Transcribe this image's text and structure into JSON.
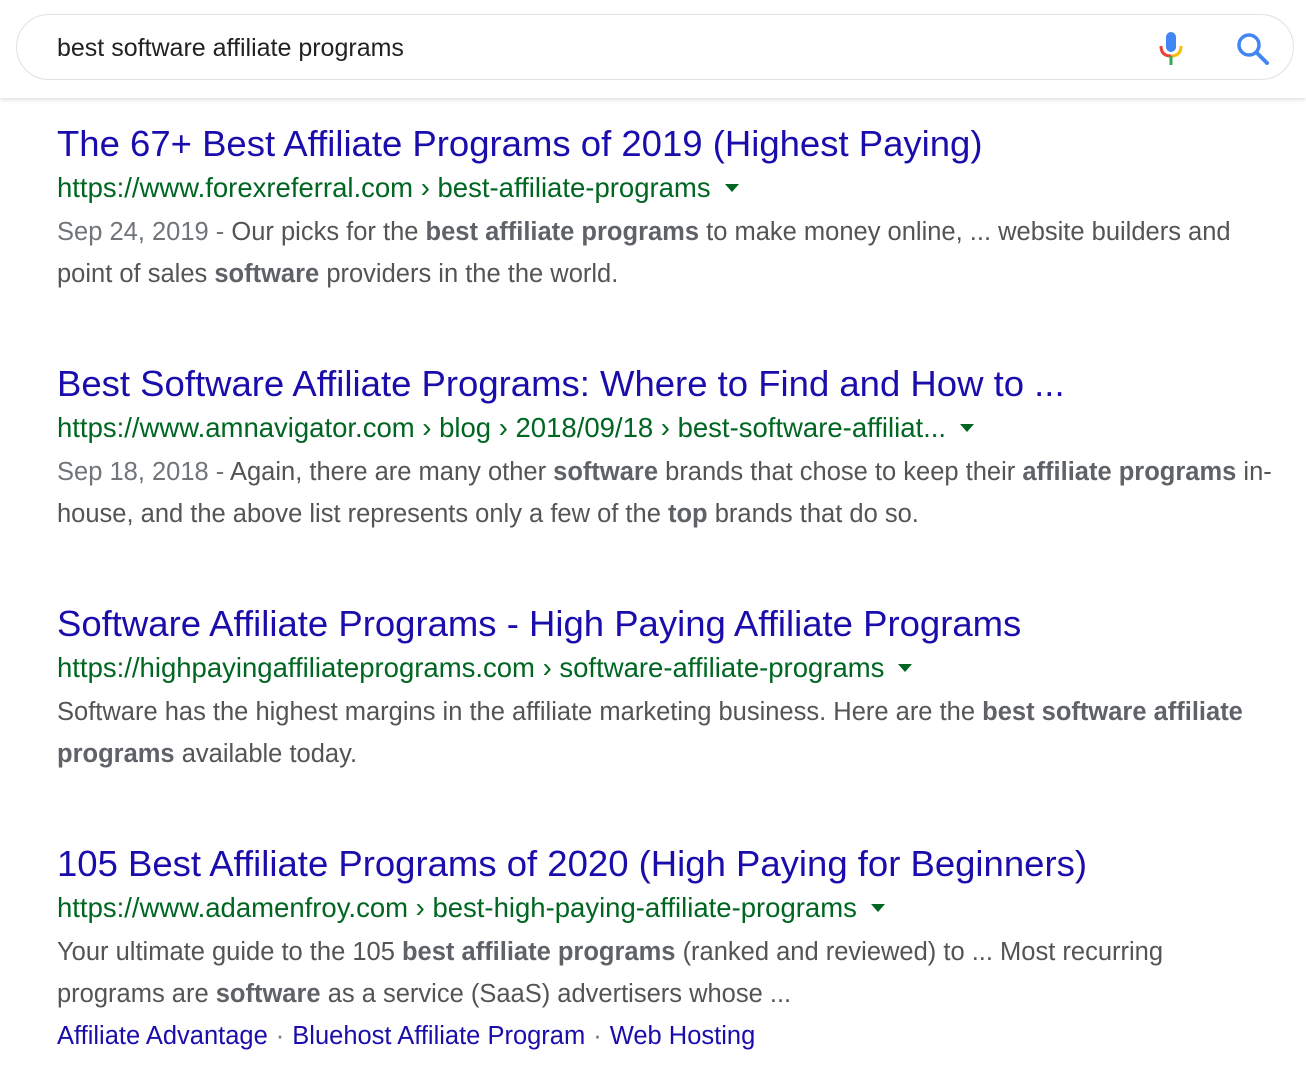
{
  "search": {
    "query": "best software affiliate programs"
  },
  "icons": {
    "mic": "microphone-icon",
    "search": "magnifier-icon"
  },
  "colors": {
    "title_link": "#1a0dab",
    "url_green": "#006621",
    "snippet_gray": "#545454",
    "mic_blue": "#4285f4",
    "mic_red": "#ea4335",
    "mic_yellow": "#fbbc05",
    "mic_green": "#34a853"
  },
  "results": [
    {
      "title": "The 67+ Best Affiliate Programs of 2019 (Highest Paying)",
      "url": "https://www.forexreferral.com › best-affiliate-programs",
      "date": "Sep 24, 2019",
      "snippet": [
        {
          "t": "Our picks for the ",
          "b": false
        },
        {
          "t": "best affiliate programs",
          "b": true
        },
        {
          "t": " to make money online, ... website builders and point of sales ",
          "b": false
        },
        {
          "t": "software",
          "b": true
        },
        {
          "t": " providers in the the world.",
          "b": false
        }
      ]
    },
    {
      "title": "Best Software Affiliate Programs: Where to Find and How to ...",
      "url": "https://www.amnavigator.com › blog › 2018/09/18 › best-software-affiliat...",
      "date": "Sep 18, 2018",
      "snippet": [
        {
          "t": "Again, there are many other ",
          "b": false
        },
        {
          "t": "software",
          "b": true
        },
        {
          "t": " brands that chose to keep their ",
          "b": false
        },
        {
          "t": "affiliate programs",
          "b": true
        },
        {
          "t": " in-house, and the above list represents only a few of the ",
          "b": false
        },
        {
          "t": "top",
          "b": true
        },
        {
          "t": " brands that do so.",
          "b": false
        }
      ]
    },
    {
      "title": "Software Affiliate Programs - High Paying Affiliate Programs",
      "url": "https://highpayingaffiliateprograms.com › software-affiliate-programs",
      "date": "",
      "snippet": [
        {
          "t": "Software has the highest margins in the affiliate marketing business. Here are the ",
          "b": false
        },
        {
          "t": "best software affiliate programs",
          "b": true
        },
        {
          "t": " available today.",
          "b": false
        }
      ]
    },
    {
      "title": "105 Best Affiliate Programs of 2020 (High Paying for Beginners)",
      "url": "https://www.adamenfroy.com › best-high-paying-affiliate-programs",
      "date": "",
      "snippet": [
        {
          "t": "Your ultimate guide to the 105 ",
          "b": false
        },
        {
          "t": "best affiliate programs",
          "b": true
        },
        {
          "t": " (ranked and reviewed) to ... Most recurring programs are ",
          "b": false
        },
        {
          "t": "software",
          "b": true
        },
        {
          "t": " as a service (SaaS) advertisers whose ...",
          "b": false
        }
      ],
      "sitelinks": [
        "Affiliate Advantage",
        "Bluehost Affiliate Program",
        "Web Hosting"
      ]
    }
  ]
}
